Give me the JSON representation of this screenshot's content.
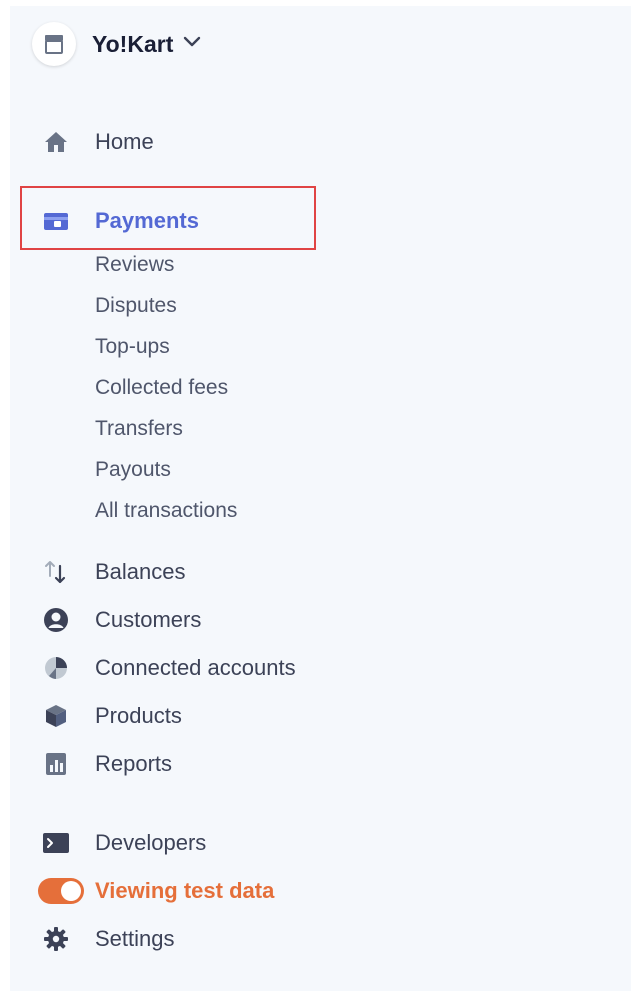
{
  "account": {
    "name": "Yo!Kart"
  },
  "nav": {
    "home": "Home",
    "payments": "Payments",
    "payments_sub": [
      "Reviews",
      "Disputes",
      "Top-ups",
      "Collected fees",
      "Transfers",
      "Payouts",
      "All transactions"
    ],
    "balances": "Balances",
    "customers": "Customers",
    "connected_accounts": "Connected accounts",
    "products": "Products",
    "reports": "Reports",
    "developers": "Developers",
    "viewing_test_data": "Viewing test data",
    "settings": "Settings"
  },
  "colors": {
    "active": "#5469d4",
    "test_mode": "#e56f3a",
    "highlight_border": "#e04444"
  }
}
